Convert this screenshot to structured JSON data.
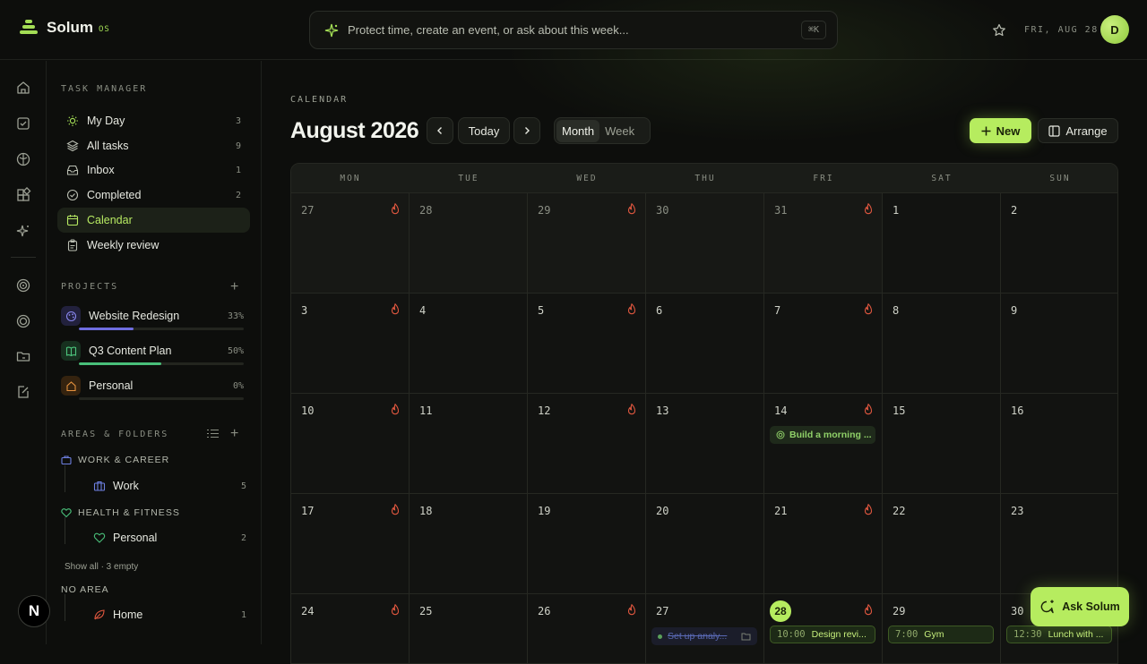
{
  "app": {
    "name": "Solum",
    "suffix": "OS"
  },
  "command": {
    "placeholder": "Protect time, create an event, or ask about this week...",
    "shortcut": "⌘K"
  },
  "header": {
    "date": "FRI, AUG 28",
    "avatar_initial": "D"
  },
  "sidebar": {
    "task_manager_title": "TASK MANAGER",
    "nav": [
      {
        "label": "My Day",
        "count": "3",
        "icon": "sun-icon"
      },
      {
        "label": "All tasks",
        "count": "9",
        "icon": "layers-icon"
      },
      {
        "label": "Inbox",
        "count": "1",
        "icon": "inbox-icon"
      },
      {
        "label": "Completed",
        "count": "2",
        "icon": "check-circle-icon"
      },
      {
        "label": "Calendar",
        "count": "",
        "icon": "calendar-icon",
        "active": true
      },
      {
        "label": "Weekly review",
        "count": "",
        "icon": "clipboard-icon"
      }
    ],
    "projects_title": "PROJECTS",
    "projects": [
      {
        "name": "Website Redesign",
        "percent": "33%",
        "progress": 0.33,
        "color": "#6f6de0"
      },
      {
        "name": "Q3 Content Plan",
        "percent": "50%",
        "progress": 0.5,
        "color": "#49c07a"
      },
      {
        "name": "Personal",
        "percent": "0%",
        "progress": 0,
        "color": "#e08a3b"
      }
    ],
    "areas_title": "AREAS & FOLDERS",
    "areas": [
      {
        "name": "WORK & CAREER",
        "icon": "briefcase-icon",
        "color": "#6d7fe0",
        "items": [
          {
            "label": "Work",
            "count": "5"
          }
        ]
      },
      {
        "name": "HEALTH & FITNESS",
        "icon": "heart-icon",
        "color": "#49c07a",
        "items": [
          {
            "label": "Personal",
            "count": "2"
          }
        ]
      }
    ],
    "show_all": "Show all · 3 empty",
    "no_area_title": "NO AREA",
    "no_area_items": [
      {
        "label": "Home",
        "count": "1"
      }
    ]
  },
  "main": {
    "section": "CALENDAR",
    "title": "August 2026",
    "today_label": "Today",
    "view_month": "Month",
    "view_week": "Week",
    "new_label": "New",
    "arrange_label": "Arrange"
  },
  "calendar": {
    "weekdays": [
      "MON",
      "TUE",
      "WED",
      "THU",
      "FRI",
      "SAT",
      "SUN"
    ],
    "weeks": [
      [
        "27",
        "28",
        "29",
        "30",
        "31",
        "1",
        "2"
      ],
      [
        "3",
        "4",
        "5",
        "6",
        "7",
        "8",
        "9"
      ],
      [
        "10",
        "11",
        "12",
        "13",
        "14",
        "15",
        "16"
      ],
      [
        "17",
        "18",
        "19",
        "20",
        "21",
        "22",
        "23"
      ],
      [
        "24",
        "25",
        "26",
        "27",
        "28",
        "29",
        "30"
      ]
    ],
    "today": "28",
    "events": {
      "habit": "Build a morning ...",
      "done": "Set up analy...",
      "e1_time": "10:00",
      "e1_title": "Design revi...",
      "e2_time": "7:00",
      "e2_title": "Gym",
      "e3_time": "12:30",
      "e3_title": "Lunch with ..."
    }
  },
  "ask_label": "Ask Solum",
  "colors": {
    "accent": "#b6ec5f",
    "flame": "#e0573f"
  }
}
